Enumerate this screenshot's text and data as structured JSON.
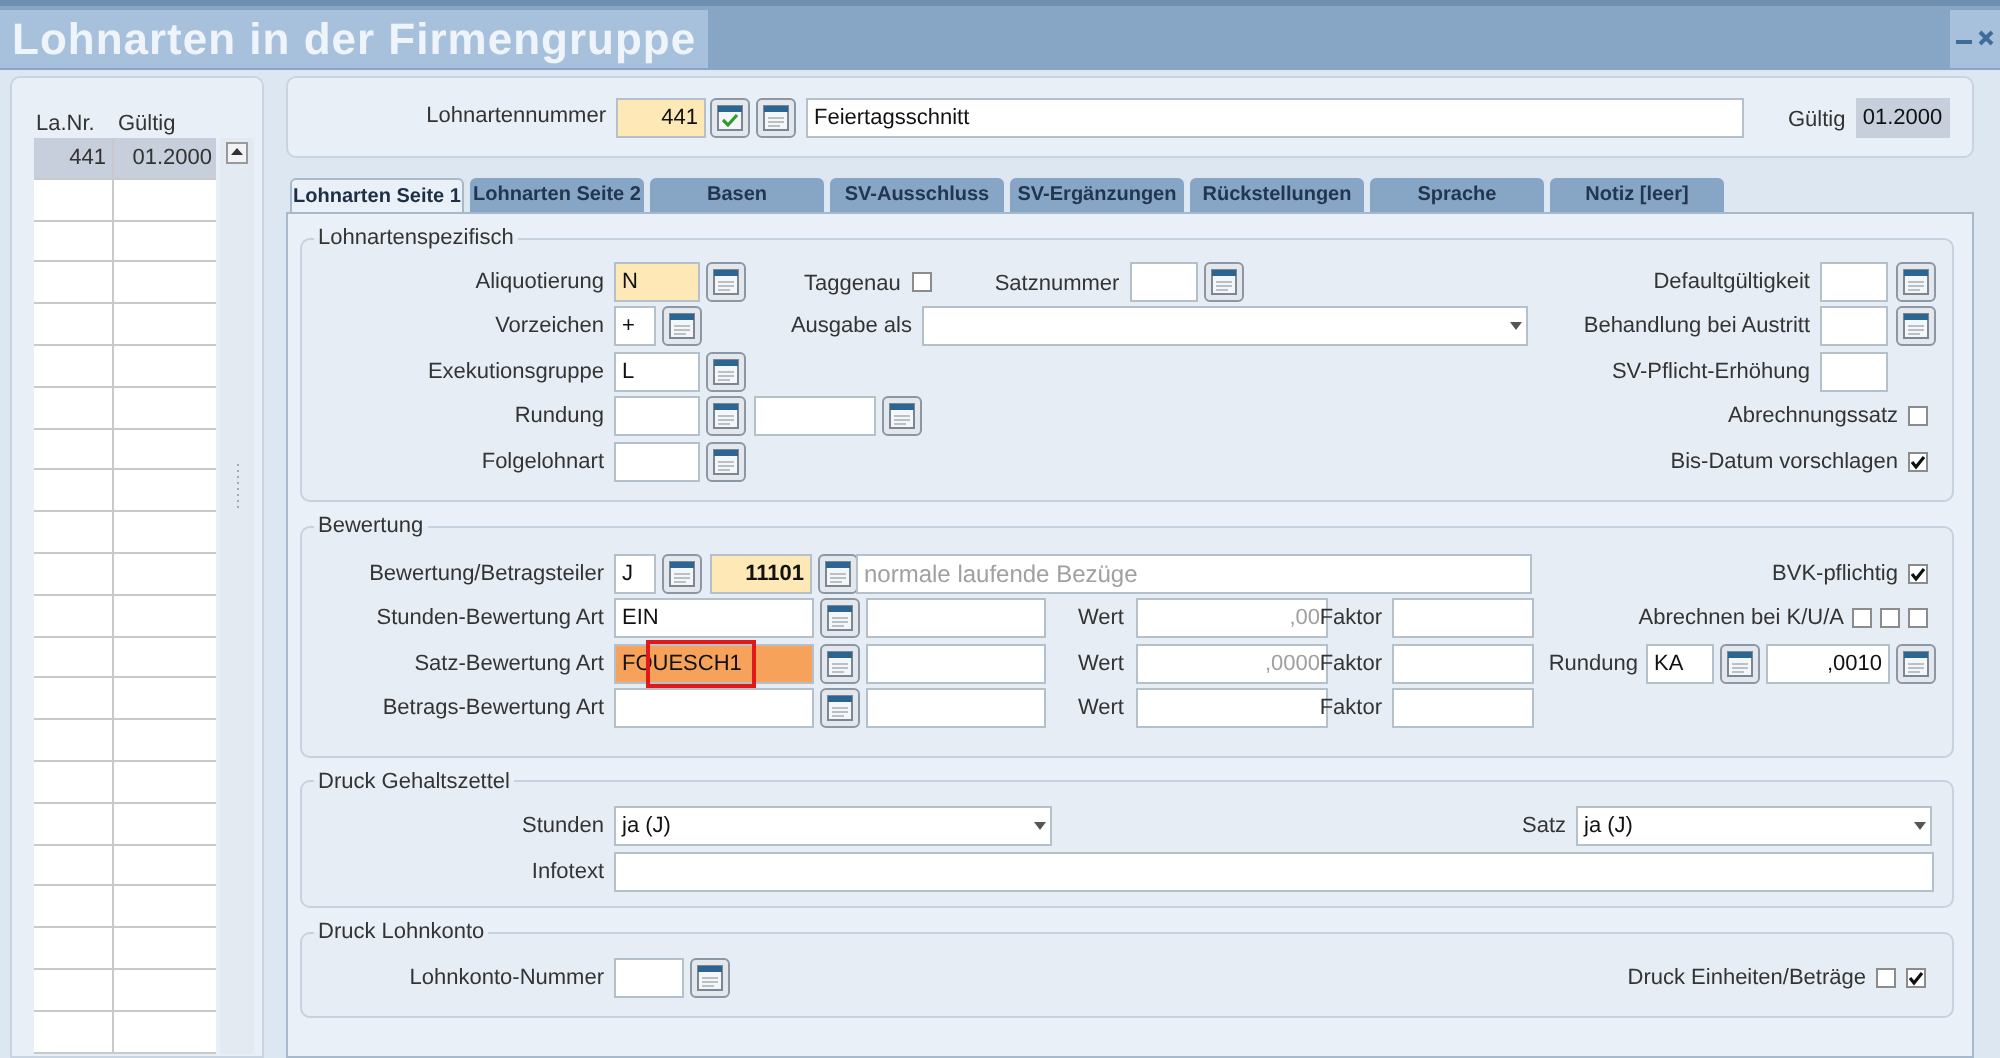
{
  "window": {
    "title": "Lohnarten in der Firmengruppe"
  },
  "list": {
    "columns": [
      "La.Nr.",
      "Gültig"
    ],
    "rows": [
      {
        "nr": "441",
        "valid": "01.2000",
        "selected": true
      }
    ]
  },
  "header": {
    "number_label": "Lohnartennummer",
    "number": "441",
    "required": true,
    "name": "Feiertagsschnitt",
    "valid_label": "Gültig",
    "valid": "01.2000"
  },
  "tabs": [
    {
      "label": "Lohnarten Seite 1",
      "selected": true
    },
    {
      "label": "Lohnarten Seite 2",
      "selected": false
    },
    {
      "label": "Basen",
      "selected": false
    },
    {
      "label": "SV-Ausschluss",
      "selected": false
    },
    {
      "label": "SV-Ergänzungen",
      "selected": false
    },
    {
      "label": "Rückstellungen",
      "selected": false
    },
    {
      "label": "Sprache",
      "selected": false
    },
    {
      "label": "Notiz [leer]",
      "selected": false
    }
  ],
  "spezifisch": {
    "title": "Lohnartenspezifisch",
    "aliquotierung": {
      "label": "Aliquotierung",
      "value": "N",
      "required": true
    },
    "taggenau": {
      "label": "Taggenau",
      "checked": false
    },
    "satznummer": {
      "label": "Satznummer"
    },
    "vorzeichen": {
      "label": "Vorzeichen",
      "value": "+"
    },
    "ausgabe_als": {
      "label": "Ausgabe als"
    },
    "exekutionsgruppe": {
      "label": "Exekutionsgruppe",
      "value": "L"
    },
    "rundung": {
      "label": "Rundung"
    },
    "folgelohnart": {
      "label": "Folgelohnart"
    },
    "right": [
      {
        "kind": "lookup",
        "label": "Defaultgültigkeit"
      },
      {
        "kind": "lookup",
        "label": "Behandlung bei Austritt"
      },
      {
        "kind": "field",
        "label": "SV-Pflicht-Erhöhung"
      },
      {
        "kind": "checkbox",
        "label": "Abrechnungssatz",
        "checked": false
      },
      {
        "kind": "checkbox",
        "label": "Bis-Datum vorschlagen",
        "checked": true
      }
    ]
  },
  "bewertung": {
    "title": "Bewertung",
    "betragsteiler": {
      "label": "Bewertung/Betragsteiler",
      "code": "J",
      "number": "11101",
      "number_required": true,
      "text": "normale laufende Bezüge",
      "text_disabled": true
    },
    "arten": [
      {
        "label": "Stunden-Bewertung Art",
        "value": "EIN",
        "focused": false,
        "marked": false,
        "wert_label": "Wert",
        "wert": {
          "value": ",00",
          "disabled": true
        },
        "faktor_label": "Faktor"
      },
      {
        "label": "Satz-Bewertung Art",
        "value": "FOUESCH1",
        "focused": true,
        "marked": true,
        "wert_label": "Wert",
        "wert": {
          "value": ",0000",
          "disabled": true
        },
        "faktor_label": "Faktor"
      },
      {
        "label": "Betrags-Bewertung Art",
        "focused": false,
        "marked": false,
        "wert_label": "Wert",
        "faktor_label": "Faktor"
      }
    ],
    "bvk": {
      "label": "BVK-pflichtig",
      "checked": true
    },
    "kua": {
      "label": "Abrechnen bei K/U/A",
      "checks": [
        {
          "checked": false
        },
        {
          "checked": false
        },
        {
          "checked": false
        }
      ]
    },
    "rundung": {
      "label": "Rundung",
      "code": "KA",
      "value": ",0010"
    }
  },
  "gehaltszettel": {
    "title": "Druck Gehaltszettel",
    "stunden": {
      "label": "Stunden",
      "value": "ja (J)"
    },
    "satz": {
      "label": "Satz",
      "value": "ja (J)"
    },
    "infotext": {
      "label": "Infotext"
    }
  },
  "lohnkonto": {
    "title": "Druck Lohnkonto",
    "nummer": {
      "label": "Lohnkonto-Nummer"
    },
    "einheiten": {
      "label": "Druck Einheiten/Beträge",
      "checks": [
        {
          "checked": false
        },
        {
          "checked": true
        }
      ]
    }
  }
}
